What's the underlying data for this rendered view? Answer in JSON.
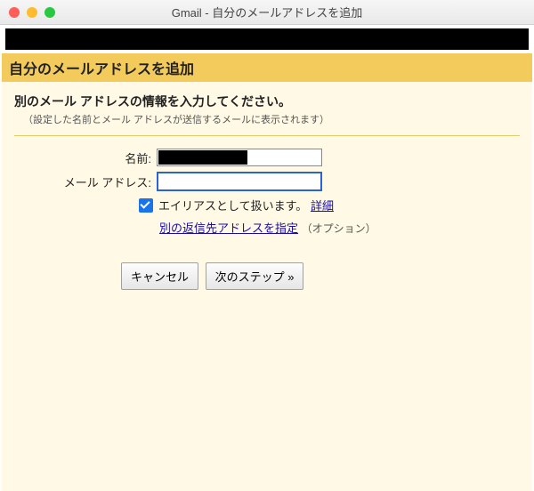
{
  "window": {
    "title": "Gmail - 自分のメールアドレスを追加"
  },
  "header": "自分のメールアドレスを追加",
  "instruction": {
    "title": "別のメール アドレスの情報を入力してください。",
    "subtitle": "（設定した名前とメール アドレスが送信するメールに表示されます）"
  },
  "form": {
    "name_label": "名前:",
    "email_label": "メール アドレス:",
    "email_value": "",
    "alias_checked": true,
    "alias_text": "エイリアスとして扱います。",
    "alias_link": "詳細",
    "reply_link": "別の返信先アドレスを指定",
    "reply_option": "（オプション）"
  },
  "buttons": {
    "cancel": "キャンセル",
    "next": "次のステップ »"
  }
}
